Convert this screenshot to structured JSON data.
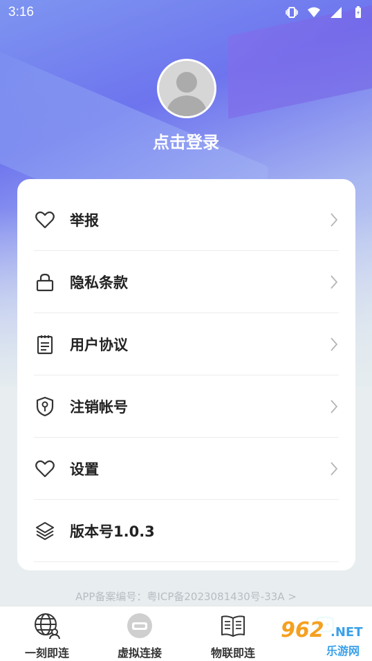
{
  "status_bar": {
    "time": "3:16"
  },
  "profile": {
    "login_label": "点击登录"
  },
  "menu": {
    "items": [
      {
        "label": "举报",
        "icon": "heart-icon",
        "has_arrow": true
      },
      {
        "label": "隐私条款",
        "icon": "lock-icon",
        "has_arrow": true
      },
      {
        "label": "用户协议",
        "icon": "clipboard-icon",
        "has_arrow": true
      },
      {
        "label": "注销帐号",
        "icon": "shield-key-icon",
        "has_arrow": true
      },
      {
        "label": "设置",
        "icon": "heart-icon",
        "has_arrow": true
      },
      {
        "label": "版本号1.0.3",
        "icon": "layers-icon",
        "has_arrow": false
      }
    ]
  },
  "footer": {
    "beian": "APP备案编号：粤ICP备2023081430号-33A >"
  },
  "tabs": [
    {
      "label": "一刻即连",
      "icon": "globe-user-icon"
    },
    {
      "label": "虚拟连接",
      "icon": "vr-headset-icon"
    },
    {
      "label": "物联即连",
      "icon": "book-icon"
    },
    {
      "label": "",
      "icon": "robot-icon"
    }
  ],
  "watermark": {
    "line1": "962",
    "line2": ".NET",
    "line3": "乐游网"
  },
  "colors": {
    "accent": "#6d74ee",
    "text": "#222222",
    "muted": "#b6bcc0"
  }
}
